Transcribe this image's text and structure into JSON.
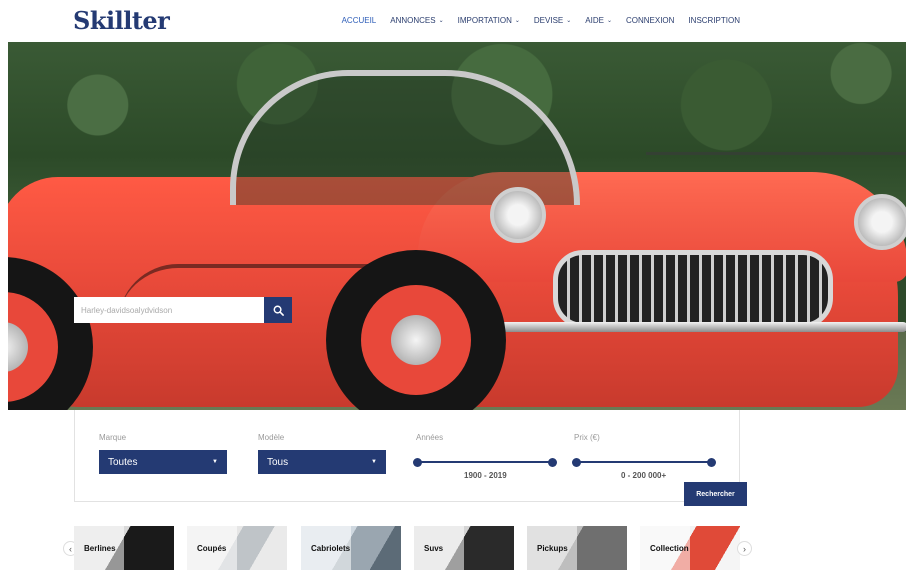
{
  "brand": {
    "logo_text": "Skillter"
  },
  "nav": [
    {
      "label": "ACCUEIL",
      "active": true,
      "dropdown": false
    },
    {
      "label": "ANNONCES",
      "active": false,
      "dropdown": true
    },
    {
      "label": "IMPORTATION",
      "active": false,
      "dropdown": true
    },
    {
      "label": "DEVISE",
      "active": false,
      "dropdown": true
    },
    {
      "label": "AIDE",
      "active": false,
      "dropdown": true
    },
    {
      "label": "CONNEXION",
      "active": false,
      "dropdown": false
    },
    {
      "label": "INSCRIPTION",
      "active": false,
      "dropdown": false
    }
  ],
  "hero": {
    "search_value": "Harley-davidsoalydvidson",
    "search_icon": "search-icon"
  },
  "filters": {
    "marque": {
      "label": "Marque",
      "value": "Toutes"
    },
    "modele": {
      "label": "Modèle",
      "value": "Tous"
    },
    "annees": {
      "label": "Années",
      "range": "1900 - 2019"
    },
    "prix": {
      "label": "Prix (€)",
      "range": "0 - 200 000+"
    },
    "submit_label": "Rechercher"
  },
  "categories": [
    {
      "label": "Berlines"
    },
    {
      "label": "Coupés"
    },
    {
      "label": "Cabriolets"
    },
    {
      "label": "Suvs"
    },
    {
      "label": "Pickups"
    },
    {
      "label": "Collection"
    }
  ],
  "colors": {
    "brand": "#243a73",
    "accent": "#2d5db8",
    "car": "#e8483a"
  }
}
